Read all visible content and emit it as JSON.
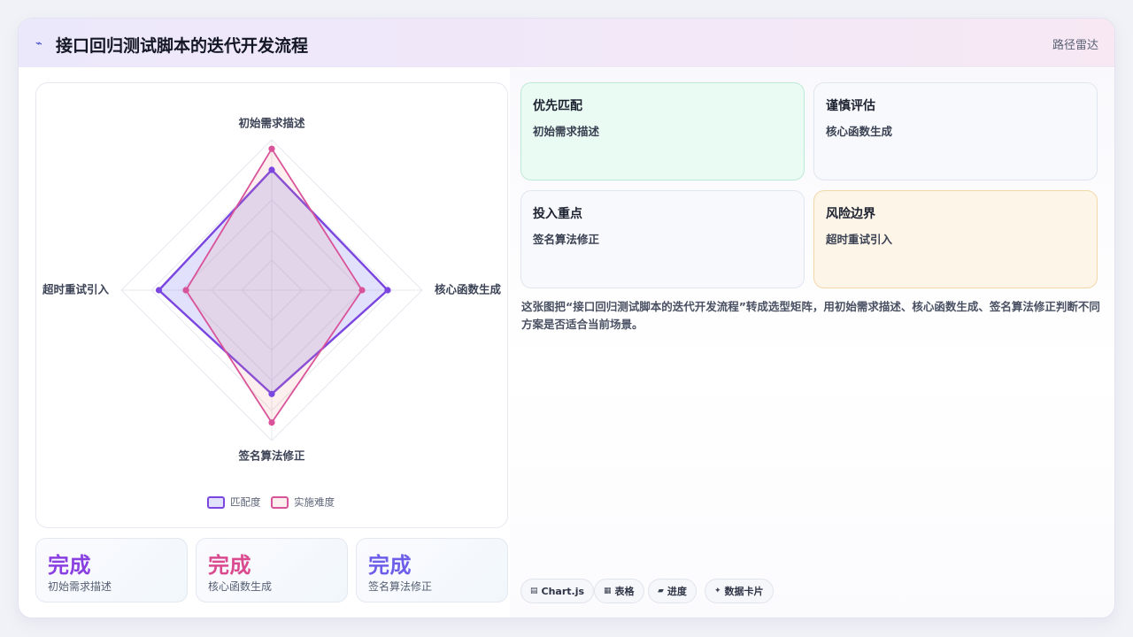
{
  "header": {
    "icon": "trend-icon",
    "title": "接口回归测试脚本的迭代开发流程",
    "tag": "路径雷达"
  },
  "chart_data": {
    "type": "radar",
    "axes": [
      "初始需求描述",
      "核心函数生成",
      "签名算法修正",
      "超时重试引入"
    ],
    "rmax": 1,
    "series": [
      {
        "name": "匹配度",
        "values": [
          0.8,
          0.77,
          0.69,
          0.75
        ],
        "color": "#7b45e0",
        "fill": "rgba(122, 120, 236, 0.22)"
      },
      {
        "name": "实施难度",
        "values": [
          0.94,
          0.6,
          0.88,
          0.57
        ],
        "color": "#d9539a",
        "fill": "rgba(236, 140, 130, 0.14)"
      }
    ],
    "legend": "bottom",
    "grid_levels": 5
  },
  "stats": [
    {
      "value": "完成",
      "label": "初始需求描述",
      "color": "#8a3fe0"
    },
    {
      "value": "完成",
      "label": "核心函数生成",
      "color": "#d94a8f"
    },
    {
      "value": "完成",
      "label": "签名算法修正",
      "color": "#6c5ee8"
    }
  ],
  "cards": [
    {
      "title": "优先匹配",
      "value": "初始需求描述"
    },
    {
      "title": "谨慎评估",
      "value": "核心函数生成"
    },
    {
      "title": "投入重点",
      "value": "签名算法修正"
    },
    {
      "title": "风险边界",
      "value": "超时重试引入"
    }
  ],
  "description": "这张图把“接口回归测试脚本的迭代开发流程”转成选型矩阵，用初始需求描述、核心函数生成、签名算法修正判断不同方案是否适合当前场景。",
  "chips": [
    {
      "icon": "table-icon",
      "glyph": "▤",
      "label": "Chart.js"
    },
    {
      "icon": "grid-icon",
      "glyph": "▦",
      "label": "表格"
    },
    {
      "icon": "progress-icon",
      "glyph": "▰",
      "label": "进度"
    },
    {
      "icon": "sparkle-icon",
      "glyph": "✦",
      "label": "数据卡片"
    }
  ]
}
